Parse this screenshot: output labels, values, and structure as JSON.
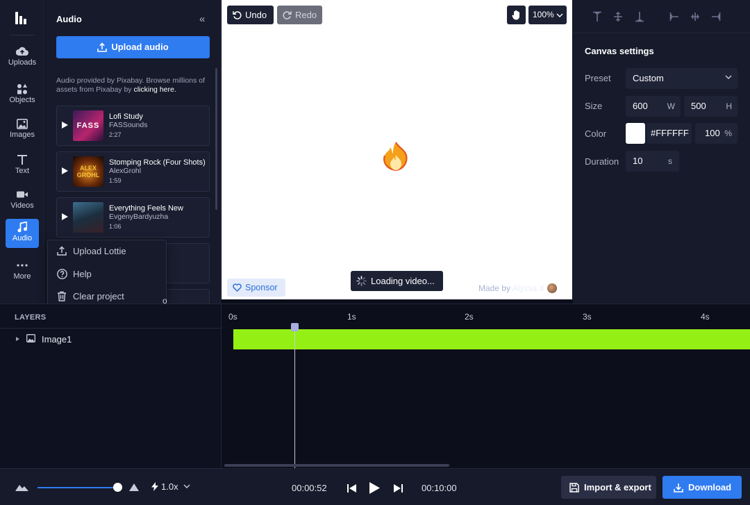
{
  "rail": {
    "items": [
      {
        "label": "Uploads",
        "icon": "cloud-upload-icon"
      },
      {
        "label": "Objects",
        "icon": "shapes-icon"
      },
      {
        "label": "Images",
        "icon": "image-icon"
      },
      {
        "label": "Text",
        "icon": "text-icon"
      },
      {
        "label": "Videos",
        "icon": "video-icon"
      },
      {
        "label": "Audio",
        "icon": "music-note-icon",
        "active": true
      },
      {
        "label": "More",
        "icon": "more-dots-icon"
      }
    ]
  },
  "audio_panel": {
    "title": "Audio",
    "upload_label": "Upload audio",
    "pixabay_text": "Audio provided by Pixabay. Browse millions of assets from Pixabay by ",
    "pixabay_link": "clicking here.",
    "tracks": [
      {
        "name": "Lofi Study",
        "artist": "FASSounds",
        "duration": "2:27",
        "thumb_text": "FASS"
      },
      {
        "name": "Stomping Rock (Four Shots)",
        "artist": "AlexGrohl",
        "duration": "1:59",
        "thumb_text": "ALEX GROHL"
      },
      {
        "name": "Everything Feels New",
        "artist": "EvgenyBardyuzha",
        "duration": "1:06",
        "thumb_text": ""
      }
    ]
  },
  "more_menu": {
    "items": [
      {
        "label": "Upload Lottie",
        "icon": "upload-icon"
      },
      {
        "label": "Help",
        "icon": "help-circle-icon"
      },
      {
        "label": "Clear project",
        "icon": "trash-icon"
      }
    ],
    "trailing_char": "o"
  },
  "canvas_toolbar": {
    "undo": "Undo",
    "redo": "Redo",
    "zoom": "100%"
  },
  "canvas": {
    "emoji": "🔥",
    "sponsor": "Sponsor",
    "loading": "Loading video...",
    "made_by": "Made by ",
    "author": "Alyssa X"
  },
  "settings": {
    "title": "Canvas settings",
    "preset_label": "Preset",
    "preset_value": "Custom",
    "size_label": "Size",
    "width": "600",
    "width_unit": "W",
    "height": "500",
    "height_unit": "H",
    "color_label": "Color",
    "color_hex": "#FFFFFF",
    "opacity": "100",
    "opacity_unit": "%",
    "duration_label": "Duration",
    "duration": "10",
    "duration_unit": "s"
  },
  "layers": {
    "header": "LAYERS",
    "items": [
      {
        "name": "Image1"
      }
    ]
  },
  "timeline": {
    "ticks": [
      "0s",
      "1s",
      "2s",
      "3s",
      "4s"
    ],
    "clip_color": "#94f014"
  },
  "bottom_bar": {
    "speed": "1.0x",
    "current_time": "00:00:52",
    "total_time": "00:10:00",
    "import_export": "Import & export",
    "download": "Download"
  }
}
